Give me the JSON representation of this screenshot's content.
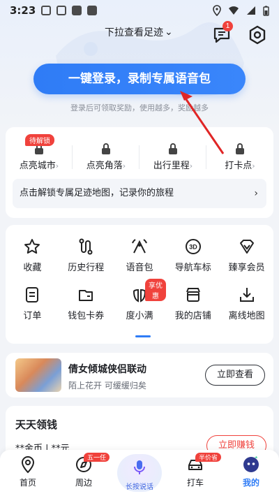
{
  "status_bar": {
    "time": "3:23"
  },
  "header": {
    "title": "下拉查看足迹",
    "title_chevron": "⌄",
    "message_badge": "1"
  },
  "login": {
    "button_label": "一键登录，录制专属语音包",
    "subtitle": "登录后可领取奖励，使用越多，奖励越多"
  },
  "footprint": {
    "items": [
      {
        "label": "点亮城市",
        "tag": "待解锁"
      },
      {
        "label": "点亮角落"
      },
      {
        "label": "出行里程"
      },
      {
        "label": "打卡点"
      }
    ],
    "chevron": "›",
    "banner_text": "点击解锁专属足迹地图，记录你的旅程",
    "banner_arrow": "›"
  },
  "services": [
    {
      "label": "收藏",
      "icon": "star-icon"
    },
    {
      "label": "历史行程",
      "icon": "route-icon"
    },
    {
      "label": "语音包",
      "icon": "voice-pack-icon"
    },
    {
      "label": "导航车标",
      "icon": "car-3d-icon"
    },
    {
      "label": "臻享会员",
      "icon": "vip-diamond-icon"
    },
    {
      "label": "订单",
      "icon": "order-icon"
    },
    {
      "label": "钱包卡券",
      "icon": "wallet-icon"
    },
    {
      "label": "度小满",
      "icon": "duxiaoman-icon",
      "tag": "享优惠"
    },
    {
      "label": "我的店铺",
      "icon": "shop-icon"
    },
    {
      "label": "离线地图",
      "icon": "download-icon"
    }
  ],
  "promo": {
    "title": "倩女倾城侠侣联动",
    "subtitle": "陌上花开 可缓缓归矣",
    "button": "立即查看"
  },
  "money": {
    "title": "天天领钱",
    "values": "**金币 | **元",
    "button": "立即赚钱"
  },
  "bottom_nav": {
    "home": "首页",
    "nearby": "周边",
    "nearby_tag": "五一任",
    "voice": "长按说话",
    "taxi": "打车",
    "taxi_tag": "半价省",
    "mine": "我的"
  },
  "colors": {
    "accent": "#2f7cf6",
    "badge": "#f0423c",
    "annotation_arrow": "#e02626"
  }
}
